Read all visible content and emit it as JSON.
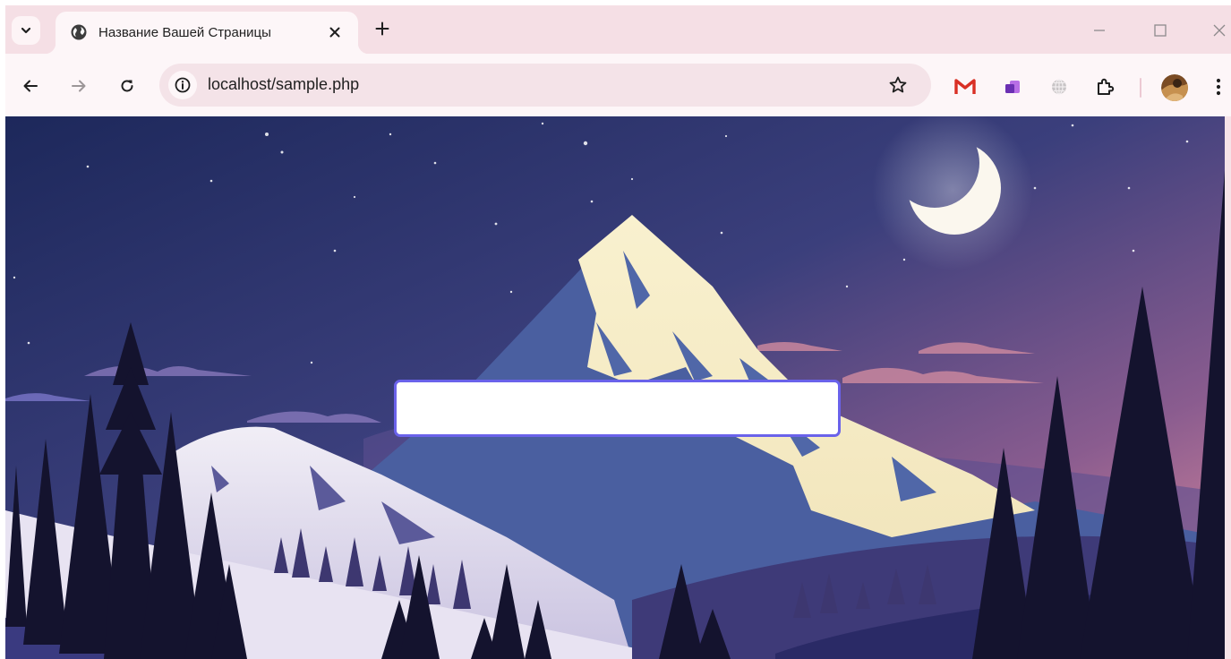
{
  "browser": {
    "tab": {
      "title": "Название Вашей Страницы",
      "favicon": "globe-icon"
    },
    "address_bar": {
      "url": "localhost/sample.php"
    },
    "extensions": [
      "gmail-icon",
      "onenote-icon",
      "globe-extension-icon",
      "puzzle-icon"
    ]
  },
  "page": {
    "input": {
      "value": "",
      "placeholder": "",
      "border_color": "#6a62ea"
    }
  },
  "colors": {
    "tab_strip": "#f5dfe5",
    "toolbar": "#fdf6f8",
    "sky_top": "#1f2a5e",
    "sky_bottom": "#e9939f"
  }
}
